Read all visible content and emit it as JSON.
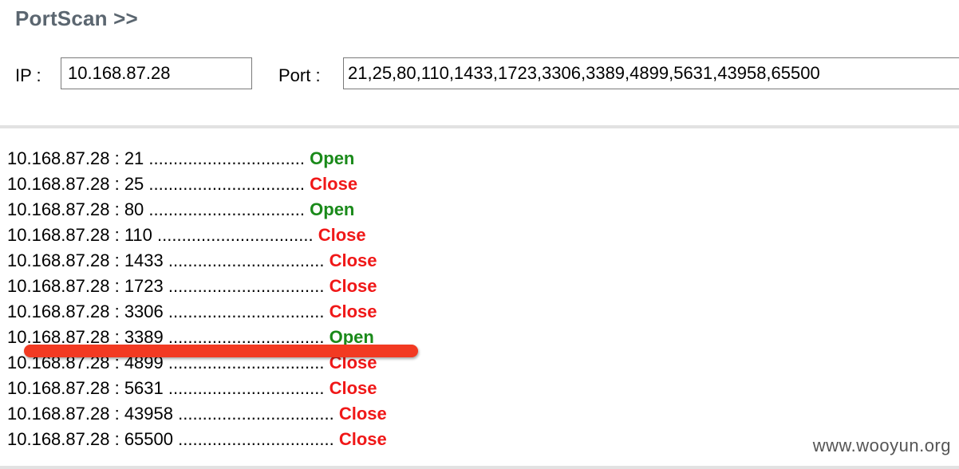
{
  "header": {
    "title": "PortScan >>"
  },
  "form": {
    "ip_label": "IP :",
    "ip_value": "10.168.87.28",
    "port_label": "Port :",
    "port_value": "21,25,80,110,1433,1723,3306,3389,4899,5631,43958,65500"
  },
  "results": [
    {
      "host": "10.168.87.28",
      "port": "21",
      "dots": "................................",
      "status": "Open"
    },
    {
      "host": "10.168.87.28",
      "port": "25",
      "dots": "................................",
      "status": "Close"
    },
    {
      "host": "10.168.87.28",
      "port": "80",
      "dots": "................................",
      "status": "Open"
    },
    {
      "host": "10.168.87.28",
      "port": "110",
      "dots": "................................",
      "status": "Close"
    },
    {
      "host": "10.168.87.28",
      "port": "1433",
      "dots": "................................",
      "status": "Close"
    },
    {
      "host": "10.168.87.28",
      "port": "1723",
      "dots": "................................",
      "status": "Close"
    },
    {
      "host": "10.168.87.28",
      "port": "3306",
      "dots": "................................",
      "status": "Close"
    },
    {
      "host": "10.168.87.28",
      "port": "3389",
      "dots": "................................",
      "status": "Open"
    },
    {
      "host": "10.168.87.28",
      "port": "4899",
      "dots": "................................",
      "status": "Close"
    },
    {
      "host": "10.168.87.28",
      "port": "5631",
      "dots": "................................",
      "status": "Close"
    },
    {
      "host": "10.168.87.28",
      "port": "43958",
      "dots": "................................",
      "status": "Close"
    },
    {
      "host": "10.168.87.28",
      "port": "65500",
      "dots": "................................",
      "status": "Close"
    }
  ],
  "annotation": {
    "highlighted_port": "3389",
    "color": "#f23a22"
  },
  "colors": {
    "open": "#1a8a1a",
    "close": "#f01818",
    "title": "#5b6670"
  },
  "watermark": "www.wooyun.org"
}
